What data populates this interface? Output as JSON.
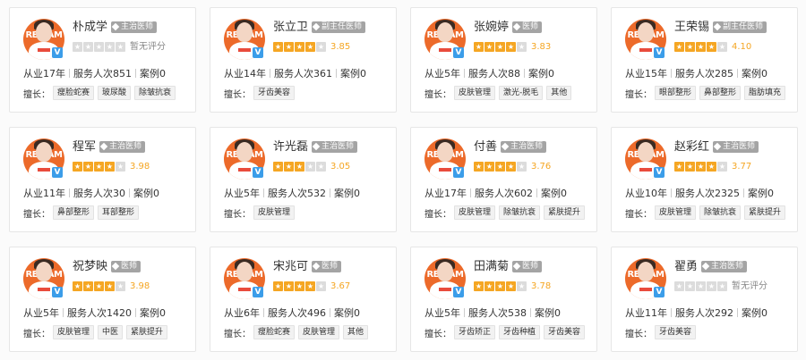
{
  "brand_text": "RED|AM",
  "labels": {
    "years_prefix": "从业",
    "service_prefix": "服务人次",
    "case_prefix": "案例",
    "skills_label": "擅长："
  },
  "colors": {
    "star_on": "#f5a623",
    "star_off": "#dcdcdc",
    "avatar_bg": "#ec6a2a",
    "verified": "#3b9de9"
  },
  "doctors": [
    {
      "name": "朴成学",
      "title": "主治医师",
      "rating": 0,
      "score": "暂无评分",
      "years": "17年",
      "service": "851",
      "cases": "0",
      "skills": [
        "瘦脸蛇赛",
        "玻尿酸",
        "除皱抗衰"
      ]
    },
    {
      "name": "张立卫",
      "title": "副主任医师",
      "rating": 4,
      "score": "3.85",
      "years": "14年",
      "service": "361",
      "cases": "0",
      "skills": [
        "牙齿美容"
      ]
    },
    {
      "name": "张婉婷",
      "title": "医师",
      "rating": 4,
      "score": "3.83",
      "years": "5年",
      "service": "88",
      "cases": "0",
      "skills": [
        "皮肤管理",
        "激光-脱毛",
        "其他"
      ]
    },
    {
      "name": "王荣锡",
      "title": "副主任医师",
      "rating": 4,
      "score": "4.10",
      "years": "15年",
      "service": "285",
      "cases": "0",
      "skills": [
        "眼部整形",
        "鼻部整形",
        "脂肪填充"
      ]
    },
    {
      "name": "程军",
      "title": "主治医师",
      "rating": 4,
      "score": "3.98",
      "years": "11年",
      "service": "30",
      "cases": "0",
      "skills": [
        "鼻部整形",
        "耳部整形"
      ]
    },
    {
      "name": "许光磊",
      "title": "主治医师",
      "rating": 3,
      "score": "3.05",
      "years": "5年",
      "service": "532",
      "cases": "0",
      "skills": [
        "皮肤管理"
      ]
    },
    {
      "name": "付善",
      "title": "主治医师",
      "rating": 4,
      "score": "3.76",
      "years": "17年",
      "service": "602",
      "cases": "0",
      "skills": [
        "皮肤管理",
        "除皱抗衰",
        "紧肤提升"
      ]
    },
    {
      "name": "赵彩红",
      "title": "主治医师",
      "rating": 4,
      "score": "3.77",
      "years": "10年",
      "service": "2325",
      "cases": "0",
      "skills": [
        "皮肤管理",
        "除皱抗衰",
        "紧肤提升"
      ]
    },
    {
      "name": "祝梦映",
      "title": "医师",
      "rating": 4,
      "score": "3.98",
      "years": "5年",
      "service": "1420",
      "cases": "0",
      "skills": [
        "皮肤管理",
        "中医",
        "紧肤提升"
      ]
    },
    {
      "name": "宋兆可",
      "title": "医师",
      "rating": 4,
      "score": "3.67",
      "years": "6年",
      "service": "496",
      "cases": "0",
      "skills": [
        "瘦脸蛇赛",
        "皮肤管理",
        "其他"
      ]
    },
    {
      "name": "田满菊",
      "title": "医师",
      "rating": 4,
      "score": "3.78",
      "years": "5年",
      "service": "538",
      "cases": "0",
      "skills": [
        "牙齿矫正",
        "牙齿种植",
        "牙齿美容"
      ]
    },
    {
      "name": "翟勇",
      "title": "主治医师",
      "rating": 0,
      "score": "暂无评分",
      "years": "11年",
      "service": "292",
      "cases": "0",
      "skills": [
        "牙齿美容"
      ]
    }
  ]
}
